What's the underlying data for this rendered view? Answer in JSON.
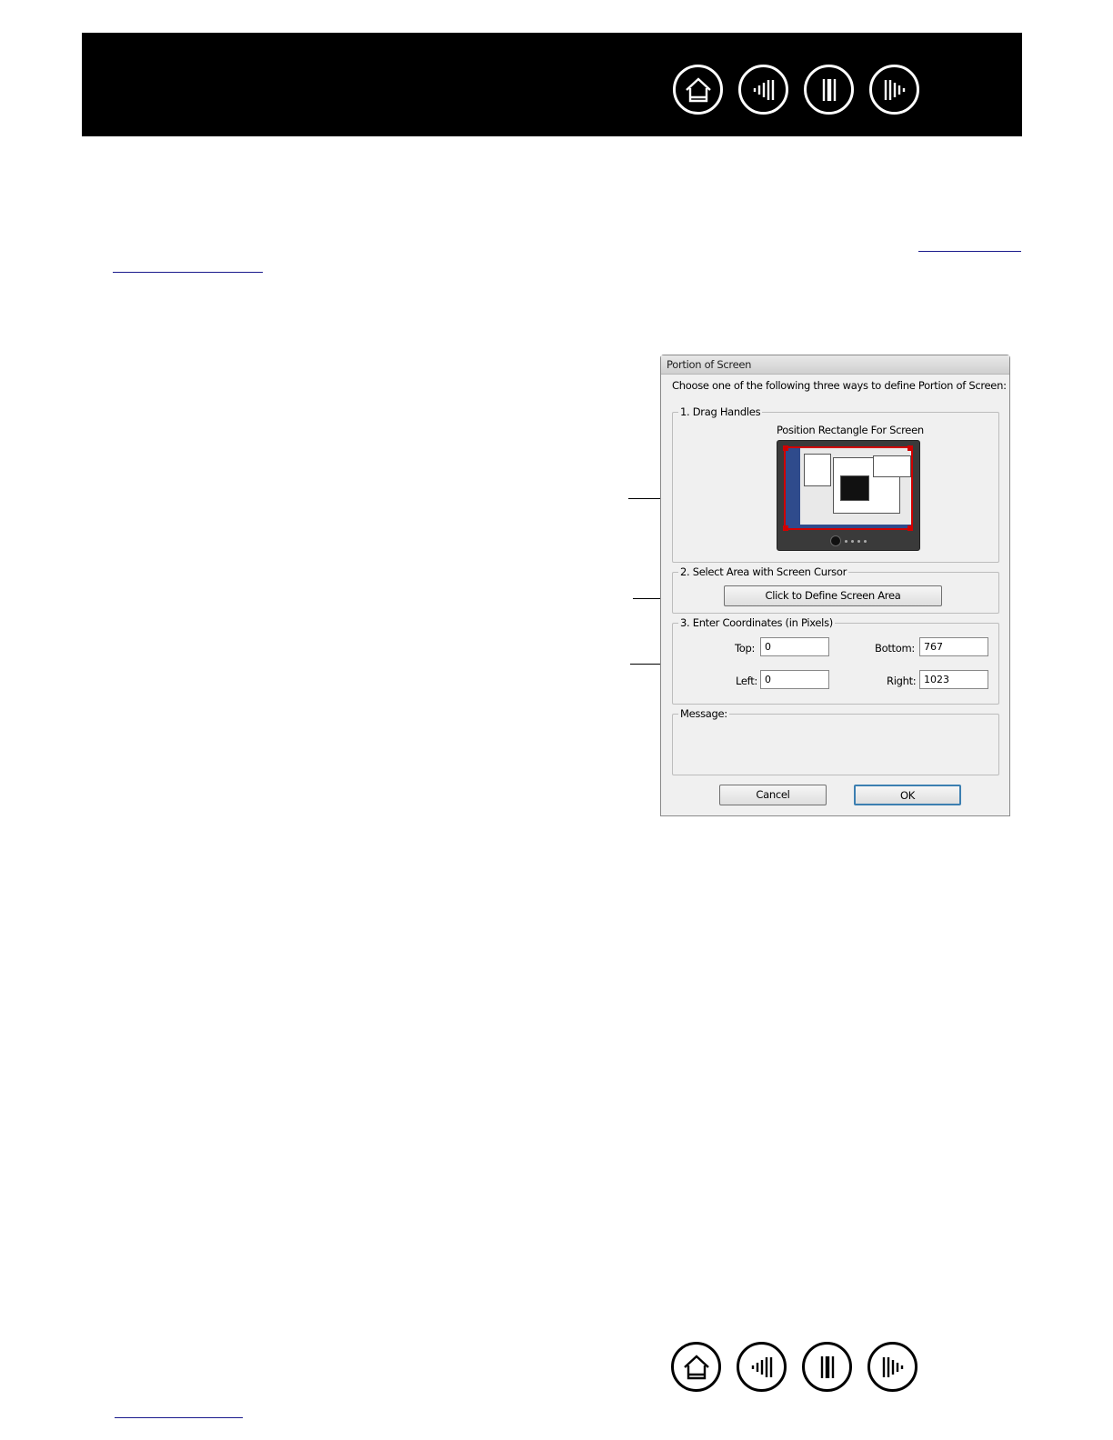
{
  "nav": {
    "icons": [
      "home-icon",
      "contents-icon",
      "index-icon",
      "forward-icon"
    ]
  },
  "dialog": {
    "title": "Portion of Screen",
    "intro": "Choose one of the following three ways to define Portion of Screen:",
    "group1": {
      "label": "1. Drag Handles",
      "caption": "Position Rectangle For Screen"
    },
    "group2": {
      "label": "2. Select Area with Screen Cursor",
      "button": "Click to Define Screen Area"
    },
    "group3": {
      "label": "3. Enter Coordinates (in Pixels)",
      "top_label": "Top:",
      "top_value": "0",
      "bottom_label": "Bottom:",
      "bottom_value": "767",
      "left_label": "Left:",
      "left_value": "0",
      "right_label": "Right:",
      "right_value": "1023"
    },
    "message_label": "Message:",
    "cancel": "Cancel",
    "ok": "OK"
  },
  "colors": {
    "header": "#000000",
    "handle": "#d00000",
    "link_underline": "#1a1a8c"
  }
}
